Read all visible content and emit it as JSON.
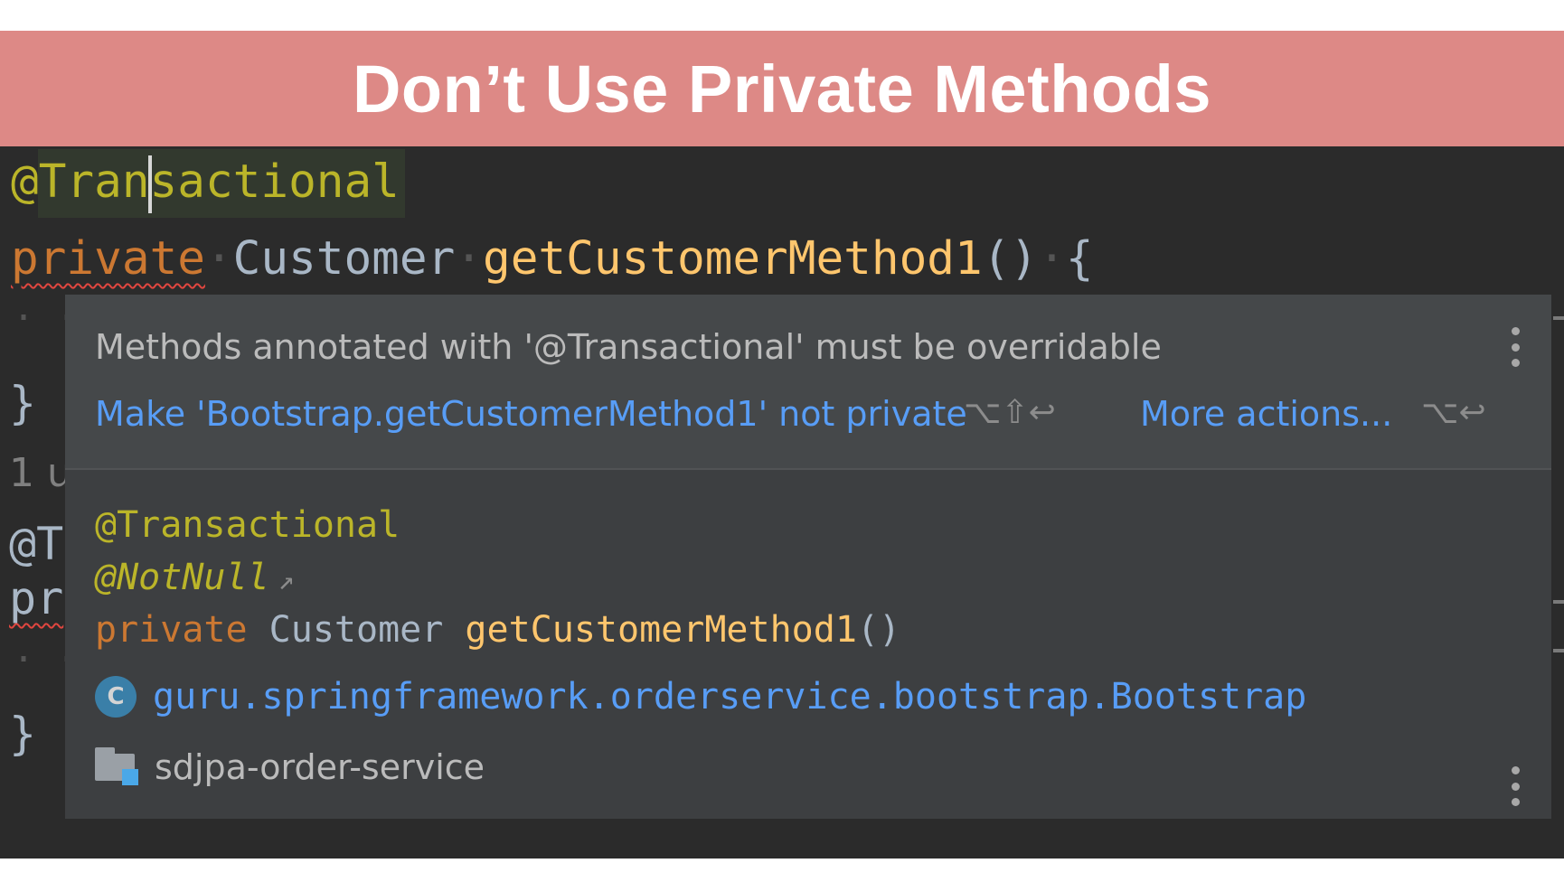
{
  "banner": {
    "title": "Don’t Use Private Methods"
  },
  "editor": {
    "line1": {
      "at": "@",
      "annotation_before_caret": "Tran",
      "annotation_after_caret": "sactional"
    },
    "line2": {
      "keyword": "private",
      "type": "Customer",
      "method": "getCustomerMethod1",
      "parens": "()",
      "brace": "{"
    },
    "left_edge": {
      "dots": "· ·",
      "close_brace_1": "}",
      "usage_hint": "1 u",
      "annot_fragment": "@T",
      "keyword_fragment": "pr",
      "dots_2": "· ·",
      "close_brace_2": "}"
    }
  },
  "popup": {
    "problem": "Methods annotated with '@Transactional' must be overridable",
    "fix_action": "Make 'Bootstrap.getCustomerMethod1' not private",
    "fix_shortcut": "⌥⇧↩",
    "more_actions": "More actions...",
    "more_shortcut": "⌥↩",
    "signature": {
      "annotation": "@Transactional",
      "not_null": "@NotNull",
      "external_arrow": "↗",
      "keyword": "private",
      "type": "Customer",
      "method": "getCustomerMethod1",
      "parens": "()"
    },
    "class_icon_letter": "C",
    "class_fqn": "guru.springframework.orderservice.bootstrap.Bootstrap",
    "module": "sdjpa-order-service"
  },
  "colors": {
    "banner": "#dd8986",
    "editor_bg": "#2b2b2b",
    "popup_bg": "#3d3f41",
    "annotation": "#bbb529",
    "keyword": "#cc7832",
    "method": "#ffc66d",
    "link": "#589df6",
    "error_squiggle": "#e0463f"
  },
  "icons": {
    "kebab": "more-vertical-icon",
    "class": "class-c-icon",
    "module": "module-folder-icon",
    "external": "external-link-arrow-icon"
  }
}
